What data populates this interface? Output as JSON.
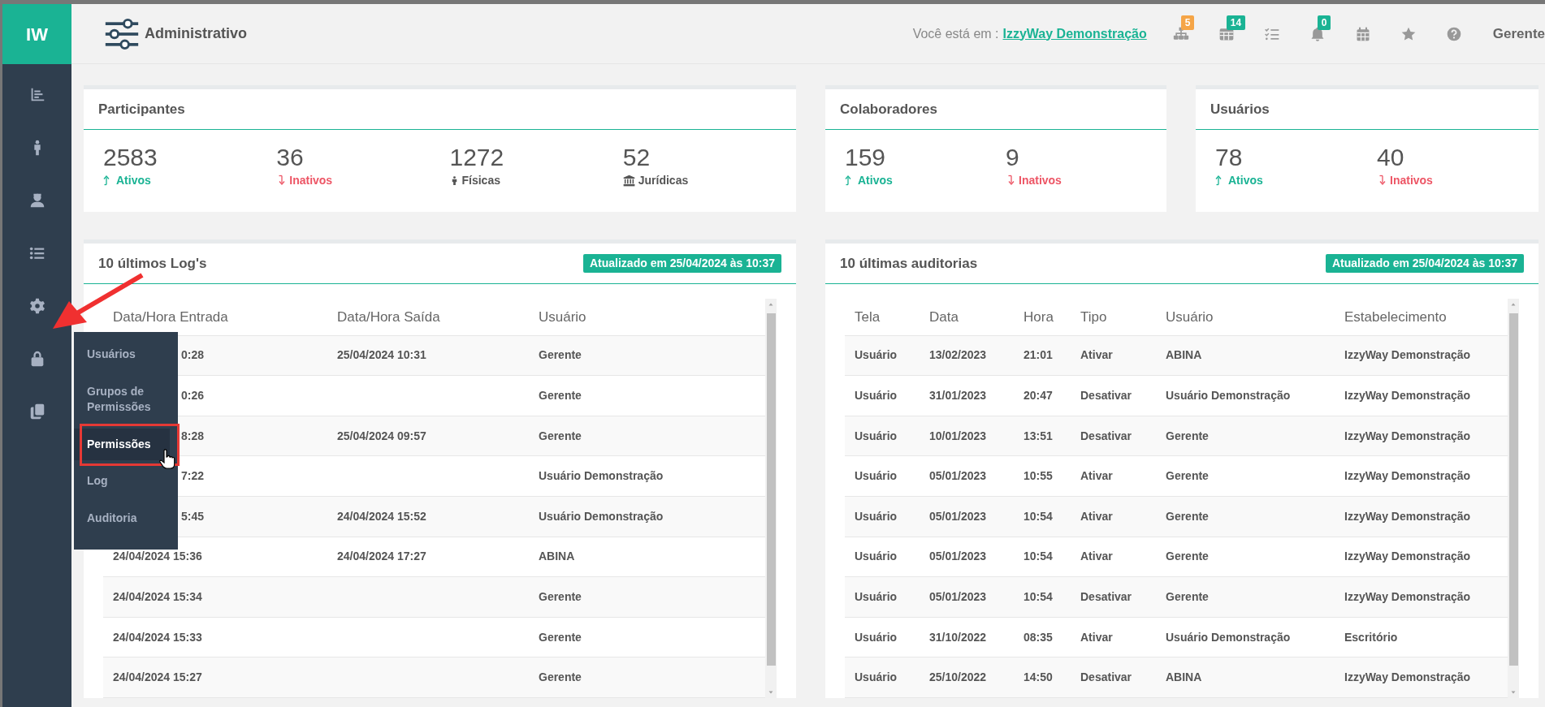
{
  "sidebar": {
    "logo": "IW"
  },
  "header": {
    "title": "Administrativo",
    "location_label": "Você está em :",
    "location": "IzzyWay Demonstração",
    "user": "Gerente"
  },
  "toolbar_badges": [
    {
      "count": "5",
      "color": "#f5a547"
    },
    {
      "count": "14",
      "color": "#1ab394"
    },
    {
      "count": "0",
      "color": "#1ab394"
    }
  ],
  "stat_cards": [
    {
      "title": "Participantes",
      "stats": [
        {
          "value": "2583",
          "label": "Ativos",
          "kind": "up"
        },
        {
          "value": "36",
          "label": "Inativos",
          "kind": "down"
        },
        {
          "value": "1272",
          "label": "Físicas",
          "kind": "person"
        },
        {
          "value": "52",
          "label": "Jurídicas",
          "kind": "bank"
        }
      ]
    },
    {
      "title": "Colaboradores",
      "stats": [
        {
          "value": "159",
          "label": "Ativos",
          "kind": "up"
        },
        {
          "value": "9",
          "label": "Inativos",
          "kind": "down"
        }
      ]
    },
    {
      "title": "Usuários",
      "stats": [
        {
          "value": "78",
          "label": "Ativos",
          "kind": "up"
        },
        {
          "value": "40",
          "label": "Inativos",
          "kind": "down"
        }
      ]
    }
  ],
  "log_panel": {
    "title": "10 últimos Log's",
    "updated": "Atualizado em 25/04/2024 às 10:37",
    "columns": [
      "Data/Hora Entrada",
      "Data/Hora Saída",
      "Usuário"
    ],
    "rows": [
      {
        "covered": true,
        "cells": [
          "0:28",
          "25/04/2024 10:31",
          "Gerente"
        ]
      },
      {
        "covered": true,
        "cells": [
          "0:26",
          null,
          "Gerente"
        ]
      },
      {
        "covered": true,
        "cells": [
          "8:28",
          "25/04/2024 09:57",
          "Gerente"
        ]
      },
      {
        "covered": true,
        "cells": [
          "7:22",
          null,
          "Usuário Demonstração"
        ]
      },
      {
        "covered": true,
        "cells": [
          "5:45",
          "24/04/2024 15:52",
          "Usuário Demonstração"
        ]
      },
      {
        "covered": false,
        "cells": [
          "24/04/2024 15:36",
          "24/04/2024 17:27",
          "ABINA"
        ]
      },
      {
        "covered": false,
        "cells": [
          "24/04/2024 15:34",
          null,
          "Gerente"
        ]
      },
      {
        "covered": false,
        "cells": [
          "24/04/2024 15:33",
          null,
          "Gerente"
        ]
      },
      {
        "covered": false,
        "cells": [
          "24/04/2024 15:27",
          null,
          "Gerente"
        ]
      }
    ]
  },
  "audit_panel": {
    "title": "10 últimas auditorias",
    "updated": "Atualizado em 25/04/2024 às 10:37",
    "columns": [
      "Tela",
      "Data",
      "Hora",
      "Tipo",
      "Usuário",
      "Estabelecimento"
    ],
    "rows": [
      [
        "Usuário",
        "13/02/2023",
        "21:01",
        "Ativar",
        "ABINA",
        "IzzyWay Demonstração"
      ],
      [
        "Usuário",
        "31/01/2023",
        "20:47",
        "Desativar",
        "Usuário Demonstração",
        "IzzyWay Demonstração"
      ],
      [
        "Usuário",
        "10/01/2023",
        "13:51",
        "Desativar",
        "Gerente",
        "IzzyWay Demonstração"
      ],
      [
        "Usuário",
        "05/01/2023",
        "10:55",
        "Ativar",
        "Gerente",
        "IzzyWay Demonstração"
      ],
      [
        "Usuário",
        "05/01/2023",
        "10:54",
        "Ativar",
        "Gerente",
        "IzzyWay Demonstração"
      ],
      [
        "Usuário",
        "05/01/2023",
        "10:54",
        "Ativar",
        "Gerente",
        "IzzyWay Demonstração"
      ],
      [
        "Usuário",
        "05/01/2023",
        "10:54",
        "Desativar",
        "Gerente",
        "IzzyWay Demonstração"
      ],
      [
        "Usuário",
        "31/10/2022",
        "08:35",
        "Ativar",
        "Usuário Demonstração",
        "Escritório"
      ],
      [
        "Usuário",
        "25/10/2022",
        "14:50",
        "Desativar",
        "ABINA",
        "IzzyWay Demonstração"
      ]
    ]
  },
  "flyout_menu": {
    "items": [
      {
        "label": "Usuários",
        "selected": false
      },
      {
        "label": "Grupos de Permissões",
        "selected": false
      },
      {
        "label": "Permissões",
        "selected": true
      },
      {
        "label": "Log",
        "selected": false
      },
      {
        "label": "Auditoria",
        "selected": false
      }
    ]
  }
}
